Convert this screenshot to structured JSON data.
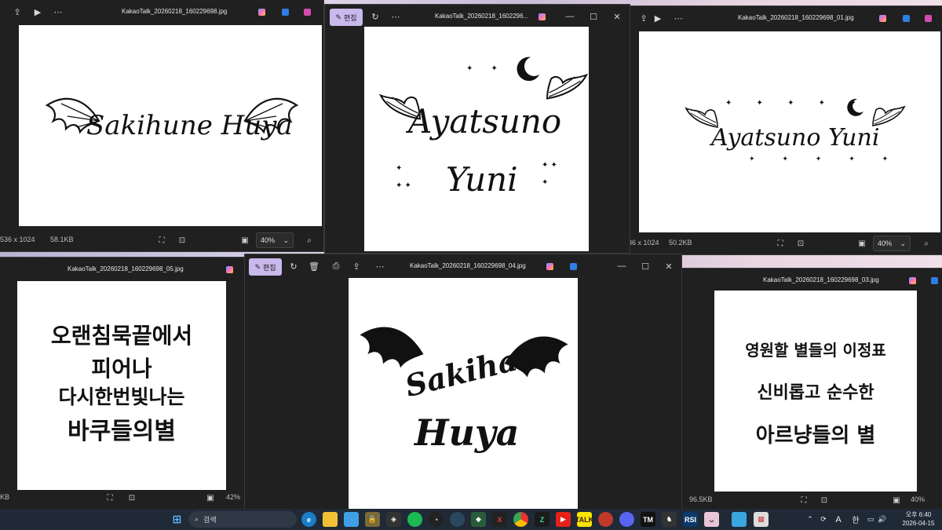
{
  "windows": {
    "w1": {
      "title": "KakaoTalk_20260218_160229698.jpg",
      "dims": "536 x 1024",
      "size": "58.1KB",
      "zoom": "40%",
      "art": "Sakihune Huya"
    },
    "w2": {
      "title": "KakaoTalk_20260218_1602296...",
      "edit": "편집",
      "art1": "Ayatsuno",
      "art2": "Yuni"
    },
    "w3": {
      "title": "KakaoTalk_20260218_160229698_01.jpg",
      "dims": "36 x 1024",
      "size": "50.2KB",
      "zoom": "40%",
      "art": "Ayatsuno Yuni"
    },
    "w4": {
      "title": "KakaoTalk_20260218_160229698_05.jpg",
      "dims": "KB",
      "zoom": "42%",
      "lines": [
        "오랜침묵끝에서",
        "피어나",
        "다시한번빛나는",
        "바쿠들의별"
      ]
    },
    "w5": {
      "title": "KakaoTalk_20260218_160229698_04.jpg",
      "edit": "편집",
      "art1": "Sakihane",
      "art2": "Huya"
    },
    "w6": {
      "title": "KakaoTalk_20260218_160229698_03.jpg",
      "size": "96.5KB",
      "zoom": "40%",
      "lines": [
        "영원할 별들의 이정표",
        "신비롭고 순수한",
        "아르냥들의 별"
      ]
    }
  },
  "taskbar": {
    "search_label": "검색",
    "ime_a": "A",
    "ime_han": "한",
    "time": "오후 6:40",
    "date": "2026-04-15"
  },
  "colors": {
    "accent_edit": "#c9b8ec",
    "window_bg": "#202020",
    "taskbar_bg": "#1f2a36"
  }
}
